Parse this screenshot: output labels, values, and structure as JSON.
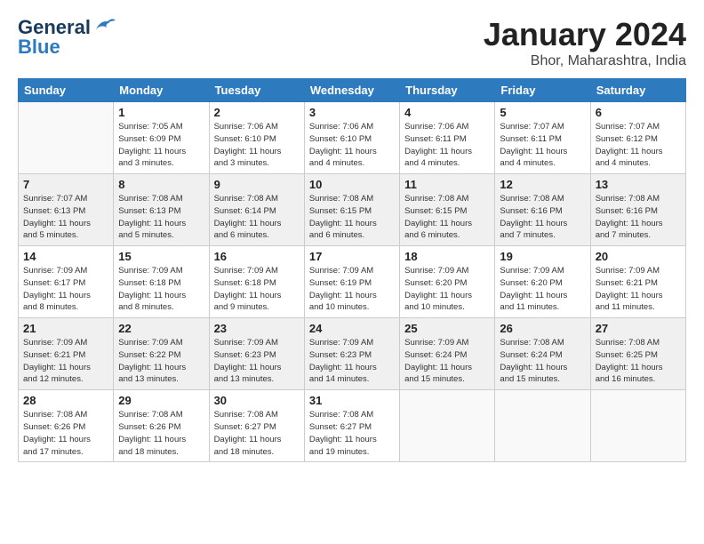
{
  "header": {
    "logo_general": "General",
    "logo_blue": "Blue",
    "main_title": "January 2024",
    "sub_title": "Bhor, Maharashtra, India"
  },
  "days_of_week": [
    "Sunday",
    "Monday",
    "Tuesday",
    "Wednesday",
    "Thursday",
    "Friday",
    "Saturday"
  ],
  "weeks": [
    [
      {
        "date": "",
        "info": ""
      },
      {
        "date": "1",
        "info": "Sunrise: 7:05 AM\nSunset: 6:09 PM\nDaylight: 11 hours\nand 3 minutes."
      },
      {
        "date": "2",
        "info": "Sunrise: 7:06 AM\nSunset: 6:10 PM\nDaylight: 11 hours\nand 3 minutes."
      },
      {
        "date": "3",
        "info": "Sunrise: 7:06 AM\nSunset: 6:10 PM\nDaylight: 11 hours\nand 4 minutes."
      },
      {
        "date": "4",
        "info": "Sunrise: 7:06 AM\nSunset: 6:11 PM\nDaylight: 11 hours\nand 4 minutes."
      },
      {
        "date": "5",
        "info": "Sunrise: 7:07 AM\nSunset: 6:11 PM\nDaylight: 11 hours\nand 4 minutes."
      },
      {
        "date": "6",
        "info": "Sunrise: 7:07 AM\nSunset: 6:12 PM\nDaylight: 11 hours\nand 4 minutes."
      }
    ],
    [
      {
        "date": "7",
        "info": "Sunrise: 7:07 AM\nSunset: 6:13 PM\nDaylight: 11 hours\nand 5 minutes."
      },
      {
        "date": "8",
        "info": "Sunrise: 7:08 AM\nSunset: 6:13 PM\nDaylight: 11 hours\nand 5 minutes."
      },
      {
        "date": "9",
        "info": "Sunrise: 7:08 AM\nSunset: 6:14 PM\nDaylight: 11 hours\nand 6 minutes."
      },
      {
        "date": "10",
        "info": "Sunrise: 7:08 AM\nSunset: 6:15 PM\nDaylight: 11 hours\nand 6 minutes."
      },
      {
        "date": "11",
        "info": "Sunrise: 7:08 AM\nSunset: 6:15 PM\nDaylight: 11 hours\nand 6 minutes."
      },
      {
        "date": "12",
        "info": "Sunrise: 7:08 AM\nSunset: 6:16 PM\nDaylight: 11 hours\nand 7 minutes."
      },
      {
        "date": "13",
        "info": "Sunrise: 7:08 AM\nSunset: 6:16 PM\nDaylight: 11 hours\nand 7 minutes."
      }
    ],
    [
      {
        "date": "14",
        "info": "Sunrise: 7:09 AM\nSunset: 6:17 PM\nDaylight: 11 hours\nand 8 minutes."
      },
      {
        "date": "15",
        "info": "Sunrise: 7:09 AM\nSunset: 6:18 PM\nDaylight: 11 hours\nand 8 minutes."
      },
      {
        "date": "16",
        "info": "Sunrise: 7:09 AM\nSunset: 6:18 PM\nDaylight: 11 hours\nand 9 minutes."
      },
      {
        "date": "17",
        "info": "Sunrise: 7:09 AM\nSunset: 6:19 PM\nDaylight: 11 hours\nand 10 minutes."
      },
      {
        "date": "18",
        "info": "Sunrise: 7:09 AM\nSunset: 6:20 PM\nDaylight: 11 hours\nand 10 minutes."
      },
      {
        "date": "19",
        "info": "Sunrise: 7:09 AM\nSunset: 6:20 PM\nDaylight: 11 hours\nand 11 minutes."
      },
      {
        "date": "20",
        "info": "Sunrise: 7:09 AM\nSunset: 6:21 PM\nDaylight: 11 hours\nand 11 minutes."
      }
    ],
    [
      {
        "date": "21",
        "info": "Sunrise: 7:09 AM\nSunset: 6:21 PM\nDaylight: 11 hours\nand 12 minutes."
      },
      {
        "date": "22",
        "info": "Sunrise: 7:09 AM\nSunset: 6:22 PM\nDaylight: 11 hours\nand 13 minutes."
      },
      {
        "date": "23",
        "info": "Sunrise: 7:09 AM\nSunset: 6:23 PM\nDaylight: 11 hours\nand 13 minutes."
      },
      {
        "date": "24",
        "info": "Sunrise: 7:09 AM\nSunset: 6:23 PM\nDaylight: 11 hours\nand 14 minutes."
      },
      {
        "date": "25",
        "info": "Sunrise: 7:09 AM\nSunset: 6:24 PM\nDaylight: 11 hours\nand 15 minutes."
      },
      {
        "date": "26",
        "info": "Sunrise: 7:08 AM\nSunset: 6:24 PM\nDaylight: 11 hours\nand 15 minutes."
      },
      {
        "date": "27",
        "info": "Sunrise: 7:08 AM\nSunset: 6:25 PM\nDaylight: 11 hours\nand 16 minutes."
      }
    ],
    [
      {
        "date": "28",
        "info": "Sunrise: 7:08 AM\nSunset: 6:26 PM\nDaylight: 11 hours\nand 17 minutes."
      },
      {
        "date": "29",
        "info": "Sunrise: 7:08 AM\nSunset: 6:26 PM\nDaylight: 11 hours\nand 18 minutes."
      },
      {
        "date": "30",
        "info": "Sunrise: 7:08 AM\nSunset: 6:27 PM\nDaylight: 11 hours\nand 18 minutes."
      },
      {
        "date": "31",
        "info": "Sunrise: 7:08 AM\nSunset: 6:27 PM\nDaylight: 11 hours\nand 19 minutes."
      },
      {
        "date": "",
        "info": ""
      },
      {
        "date": "",
        "info": ""
      },
      {
        "date": "",
        "info": ""
      }
    ]
  ]
}
